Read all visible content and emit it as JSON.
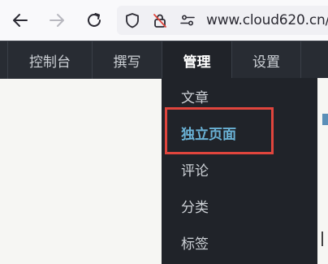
{
  "browser": {
    "url": "www.cloud620.cn/",
    "icons": [
      "back-arrow-icon",
      "forward-arrow-icon",
      "reload-icon",
      "shield-icon",
      "lock-slash-icon",
      "permissions-icon"
    ]
  },
  "admin_nav": {
    "items": [
      {
        "label": "控制台"
      },
      {
        "label": "撰写"
      },
      {
        "label": "管理"
      },
      {
        "label": "设置"
      }
    ]
  },
  "dropdown": {
    "items": [
      {
        "label": "文章"
      },
      {
        "label": "独立页面"
      },
      {
        "label": "评论"
      },
      {
        "label": "分类"
      },
      {
        "label": "标签"
      }
    ]
  },
  "colors": {
    "nav_bg": "#282c33",
    "dropdown_bg": "#202329",
    "active_link": "#6ab2d6",
    "highlight_border": "#e0453d",
    "page_bg": "#f6f6f3"
  }
}
